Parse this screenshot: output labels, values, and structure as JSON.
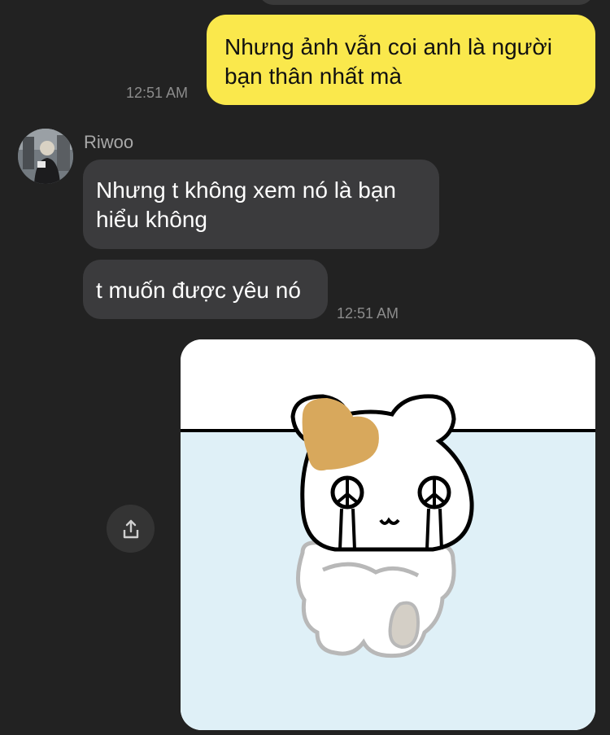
{
  "messages": {
    "outgoing": {
      "text": "Nhưng ảnh vẫn coi anh là người bạn thân nhất mà",
      "time": "12:51 AM"
    },
    "incoming": {
      "sender": "Riwoo",
      "bubbles": [
        "Nhưng t không xem nó là bạn hiểu không",
        "t muốn được yêu nó"
      ],
      "time": "12:51 AM"
    },
    "image_message": {
      "sticker": "crying-hamster-sticker"
    }
  },
  "icons": {
    "share": "share-icon"
  },
  "colors": {
    "background": "#222222",
    "outgoing_bubble": "#fae84c",
    "incoming_bubble": "#3b3b3d",
    "timestamp": "#8c8c8c"
  }
}
